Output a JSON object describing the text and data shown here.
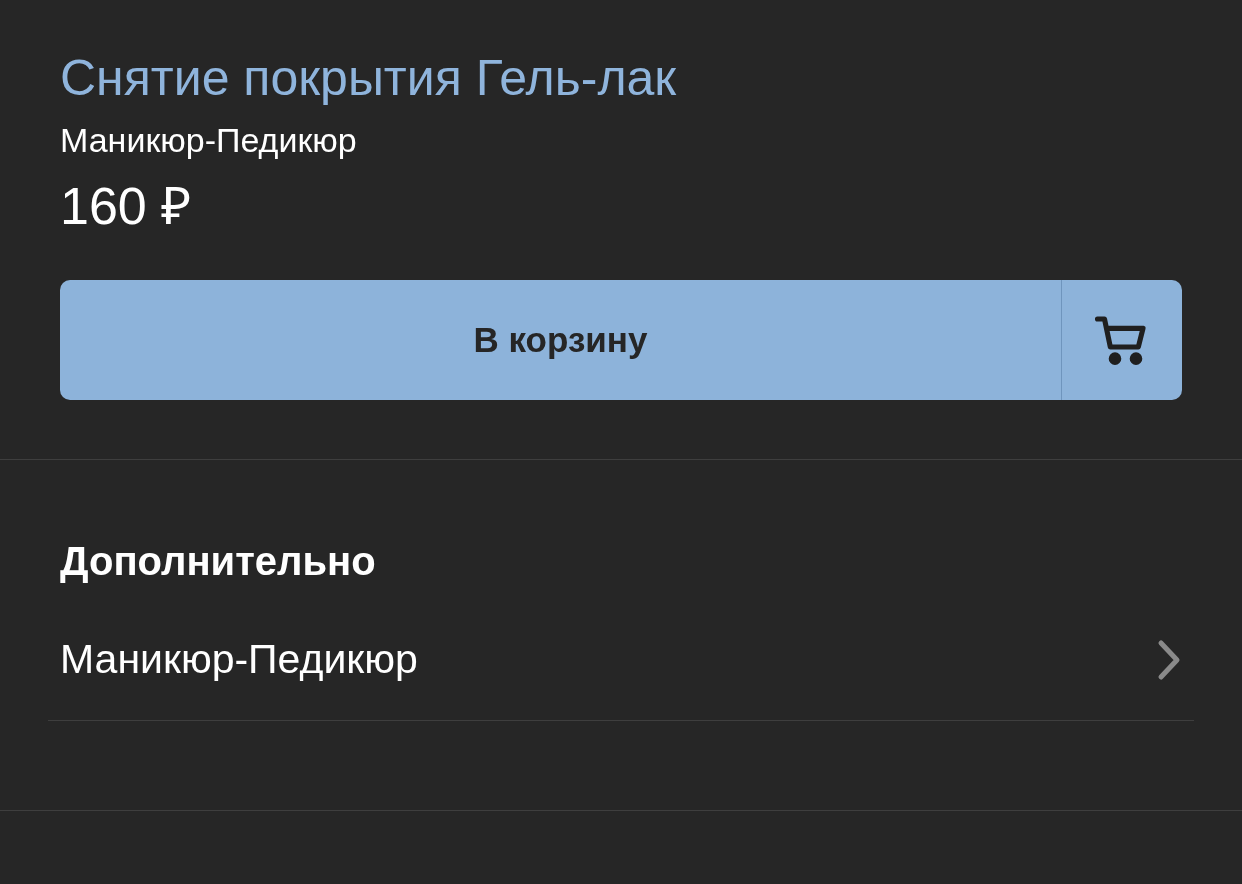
{
  "product": {
    "title": "Снятие покрытия Гель-лак",
    "category": "Маникюр-Педикюр",
    "price": "160 ₽"
  },
  "cart_button": {
    "label": "В корзину"
  },
  "additional": {
    "heading": "Дополнительно",
    "items": [
      {
        "label": "Маникюр-Педикюр"
      }
    ]
  }
}
